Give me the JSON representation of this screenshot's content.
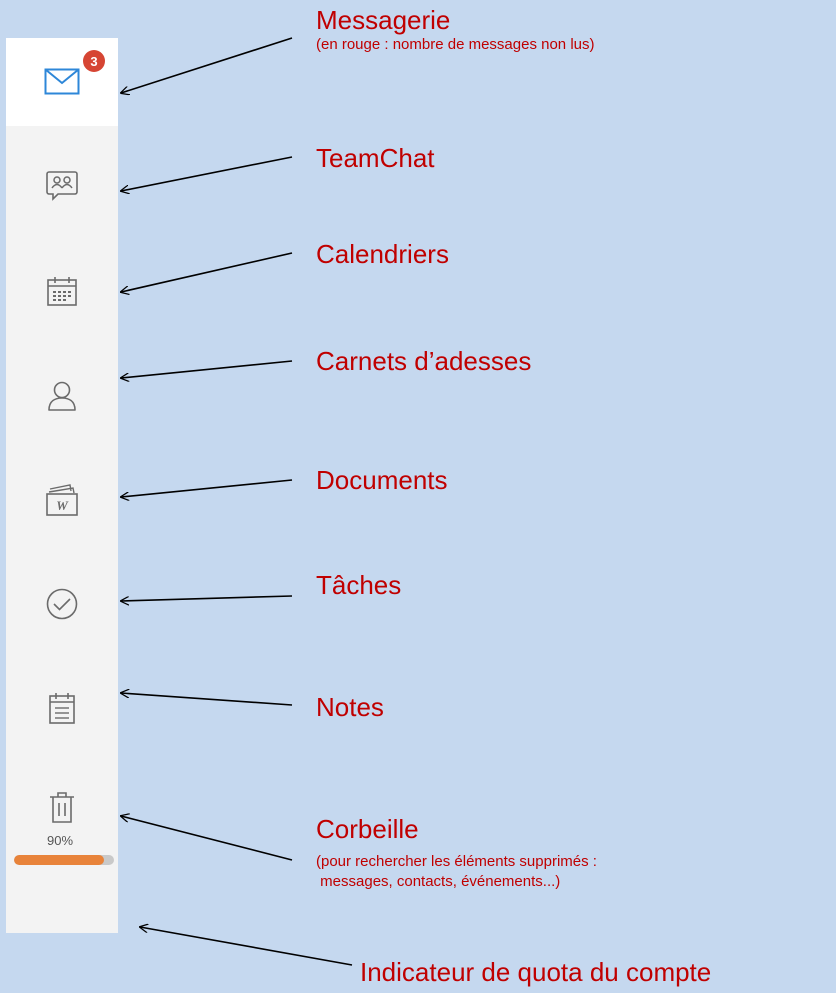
{
  "sidebar": {
    "items": [
      {
        "name": "mail",
        "icon": "mail-icon",
        "badge": "3"
      },
      {
        "name": "teamchat",
        "icon": "chat-bubble-people-icon"
      },
      {
        "name": "calendar",
        "icon": "calendar-icon"
      },
      {
        "name": "contacts",
        "icon": "person-icon"
      },
      {
        "name": "documents",
        "icon": "documents-folder-icon"
      },
      {
        "name": "tasks",
        "icon": "check-circle-icon"
      },
      {
        "name": "notes",
        "icon": "notepad-icon"
      },
      {
        "name": "trash",
        "icon": "trash-icon"
      }
    ],
    "quota": {
      "label": "90%",
      "percent": 90,
      "fill_color": "#e8833a"
    }
  },
  "annotations": {
    "mail": {
      "title": "Messagerie",
      "subtitle": "(en rouge : nombre de messages non lus)"
    },
    "teamchat": {
      "title": "TeamChat"
    },
    "calendar": {
      "title": "Calendriers"
    },
    "contacts": {
      "title": "Carnets d’adesses"
    },
    "documents": {
      "title": "Documents"
    },
    "tasks": {
      "title": "Tâches"
    },
    "notes": {
      "title": "Notes"
    },
    "trash": {
      "title": "Corbeille",
      "subtitle_1": "(pour rechercher les éléments supprimés :",
      "subtitle_2": " messages, contacts, événements...)"
    },
    "quota": {
      "title": "Indicateur de quota du compte"
    }
  },
  "colors": {
    "background": "#c5d8ef",
    "annotation_text": "#c00000",
    "badge": "#d64533",
    "icon_active": "#2e87d8",
    "icon_default": "#6b6b6b"
  }
}
